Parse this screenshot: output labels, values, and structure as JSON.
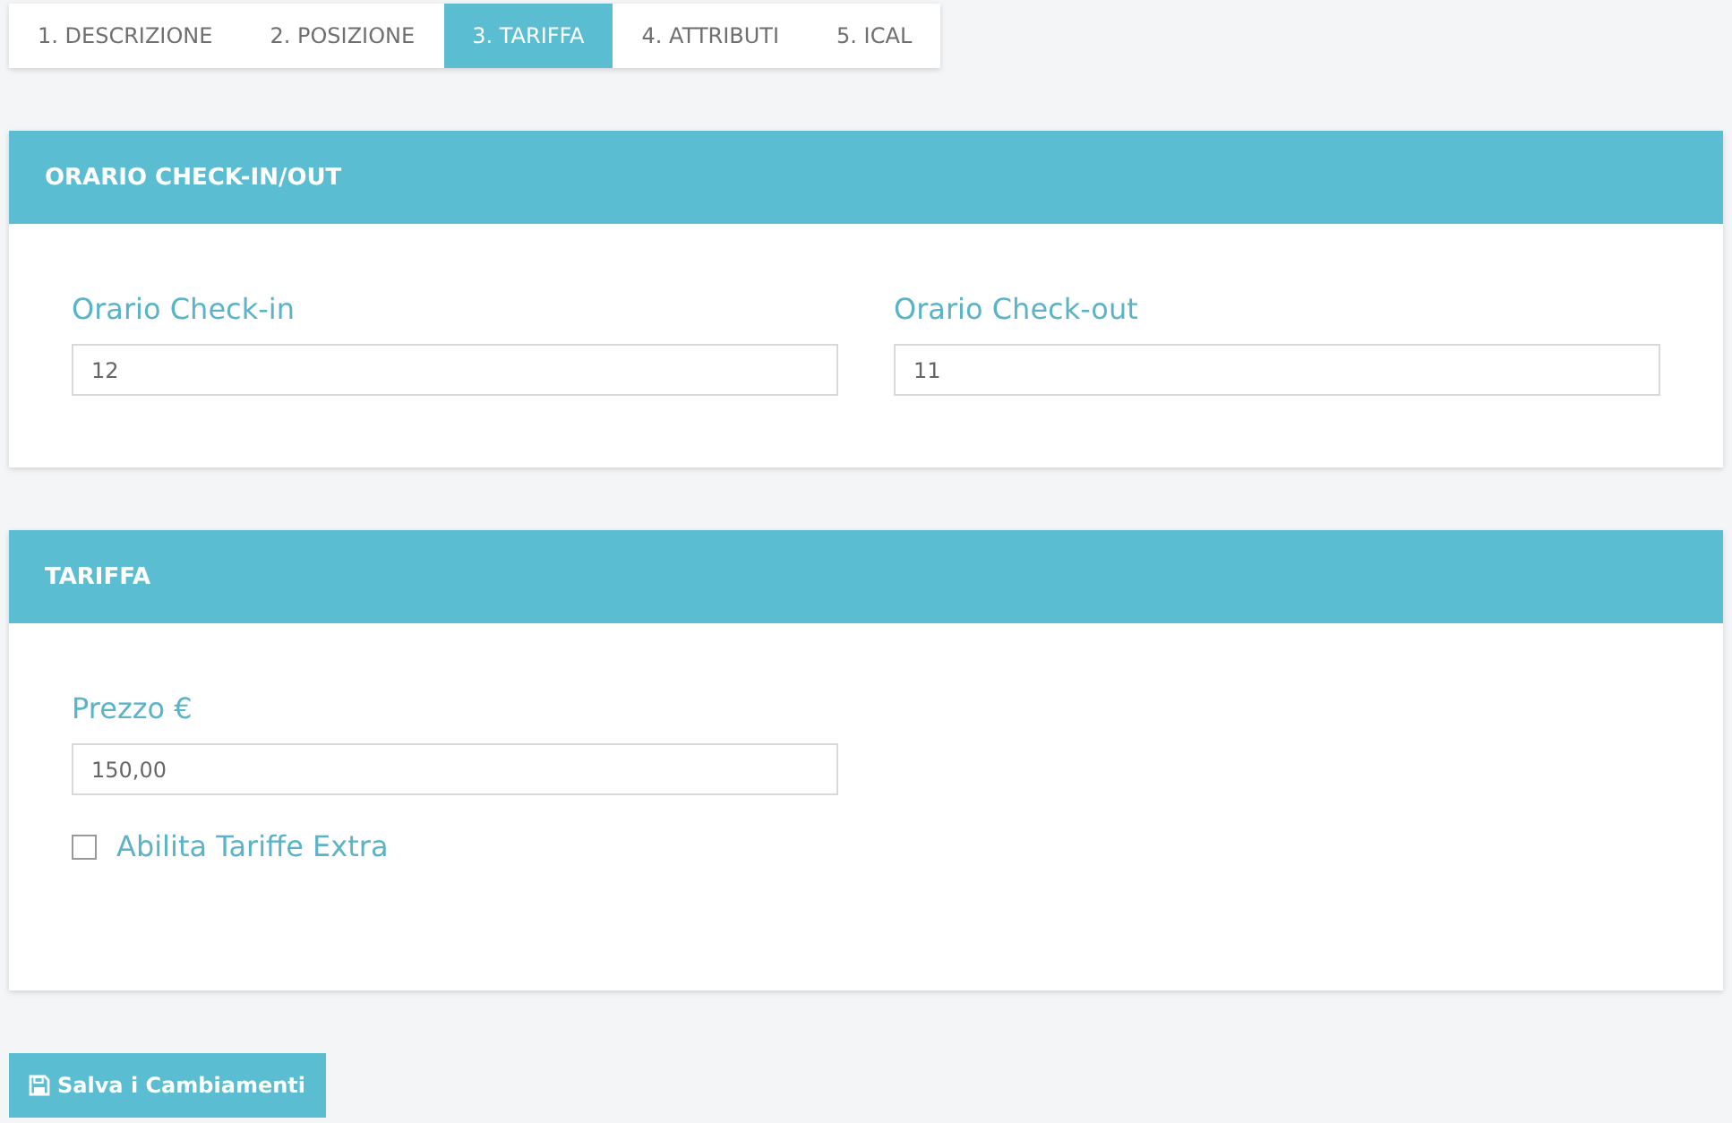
{
  "tabs": [
    {
      "label": "1. DESCRIZIONE",
      "selected": false
    },
    {
      "label": "2. POSIZIONE",
      "selected": false
    },
    {
      "label": "3. TARIFFA",
      "selected": true
    },
    {
      "label": "4. ATTRIBUTI",
      "selected": false
    },
    {
      "label": "5. ICAL",
      "selected": false
    }
  ],
  "panels": [
    {
      "title": "ORARIO CHECK-IN/OUT",
      "fields": [
        {
          "kind": "text",
          "label": "Orario Check-in",
          "value": "12"
        },
        {
          "kind": "text",
          "label": "Orario Check-out",
          "value": "11"
        }
      ]
    },
    {
      "title": "TARIFFA",
      "fields": [
        {
          "kind": "text",
          "label": "Prezzo €",
          "value": "150,00"
        },
        {
          "kind": "checkbox",
          "label": "Abilita Tariffe Extra",
          "checked": false
        }
      ]
    }
  ],
  "save_button": {
    "label": "Salva i Cambiamenti"
  }
}
